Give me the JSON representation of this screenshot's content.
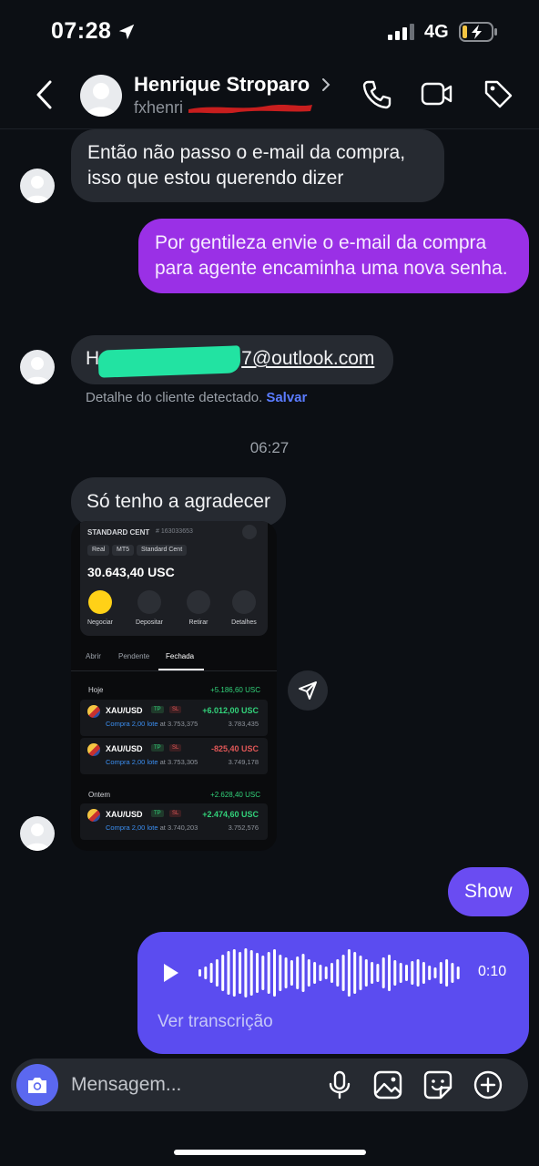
{
  "status_bar": {
    "time": "07:28",
    "network": "4G"
  },
  "header": {
    "name": "Henrique Stroparo",
    "handle": "fxhenri"
  },
  "messages": {
    "m1": "Então não passo o e-mail da compra, isso que estou querendo dizer",
    "m2": "Por gentileza envie o e-mail da compra para agente encaminha uma nova senha.",
    "m3_prefix": "H",
    "m3_email": "7@outlook.com",
    "detected_text": "Detalhe do cliente detectado.",
    "detected_action": "Salvar",
    "separator_time": "06:27",
    "m4": "Só tenho a agradecer",
    "m5": "Show"
  },
  "screenshot": {
    "account_type": "STANDARD CENT",
    "account_number": "# 163033653",
    "pills": [
      "Real",
      "MT5",
      "Standard Cent"
    ],
    "balance": "30.643,40 USC",
    "actions": [
      "Negociar",
      "Depositar",
      "Retirar",
      "Detalhes"
    ],
    "tabs": [
      "Abrir",
      "Pendente",
      "Fechada"
    ],
    "groups": [
      {
        "label": "Hoje",
        "total": "+5.186,60 USC"
      },
      {
        "label": "Ontem",
        "total": "+2.628,40 USC"
      }
    ],
    "trades": [
      {
        "symbol": "XAU/USD",
        "tp": "TP",
        "sl": "SL",
        "pnl": "+6.012,00 USC",
        "buy": "Compra 2,00 lote",
        "open": "at 3.753,375",
        "close": "3.783,435"
      },
      {
        "symbol": "XAU/USD",
        "tp": "TP",
        "sl": "SL",
        "pnl": "-825,40 USC",
        "buy": "Compra 2,00 lote",
        "open": "at 3.753,305",
        "close": "3.749,178"
      },
      {
        "symbol": "XAU/USD",
        "tp": "TP",
        "sl": "SL",
        "pnl": "+2.474,60 USC",
        "buy": "Compra 2,00 lote",
        "open": "at 3.740,203",
        "close": "3.752,576"
      }
    ]
  },
  "voice": {
    "duration": "0:10",
    "transcribe_label": "Ver transcrição",
    "progress": 0
  },
  "composer": {
    "placeholder": "Mensagem..."
  },
  "colors": {
    "background": "#0c0f14",
    "incoming_bubble": "#262a31",
    "outgoing_bubble": "#9a30e6",
    "outgoing_short": "#6a4cf2",
    "voice_bubble": "#5b4cf0",
    "accent": "#5b7cff"
  },
  "icons": [
    "location-arrow-icon",
    "signal-icon",
    "battery-icon",
    "back-icon",
    "chevron-right-icon",
    "phone-icon",
    "video-icon",
    "tag-icon",
    "share-icon",
    "play-icon",
    "camera-icon",
    "mic-icon",
    "gallery-icon",
    "sticker-icon",
    "plus-icon"
  ]
}
